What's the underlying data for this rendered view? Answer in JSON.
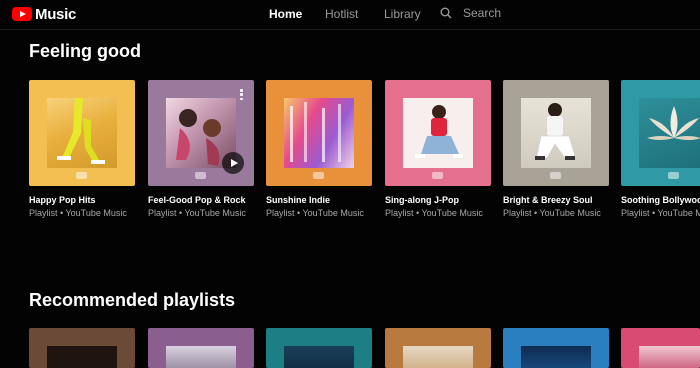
{
  "app": {
    "logo_text": "Music"
  },
  "nav": {
    "home": "Home",
    "hotlist": "Hotlist",
    "library": "Library",
    "search_label": "Search"
  },
  "sections": {
    "feeling_good": {
      "title": "Feeling good",
      "cards": [
        {
          "title": "Happy Pop Hits",
          "subtitle": "Playlist • YouTube Music"
        },
        {
          "title": "Feel-Good Pop & Rock",
          "subtitle": "Playlist • YouTube Music"
        },
        {
          "title": "Sunshine Indie",
          "subtitle": "Playlist • YouTube Music"
        },
        {
          "title": "Sing-along J-Pop",
          "subtitle": "Playlist • YouTube Music"
        },
        {
          "title": "Bright & Breezy Soul",
          "subtitle": "Playlist • YouTube Music"
        },
        {
          "title": "Soothing Bollywood",
          "subtitle": "Playlist • YouTube Music"
        }
      ]
    },
    "recommended": {
      "title": "Recommended playlists"
    }
  },
  "colors": {
    "brand_red": "#ff0000",
    "background": "#030303"
  }
}
